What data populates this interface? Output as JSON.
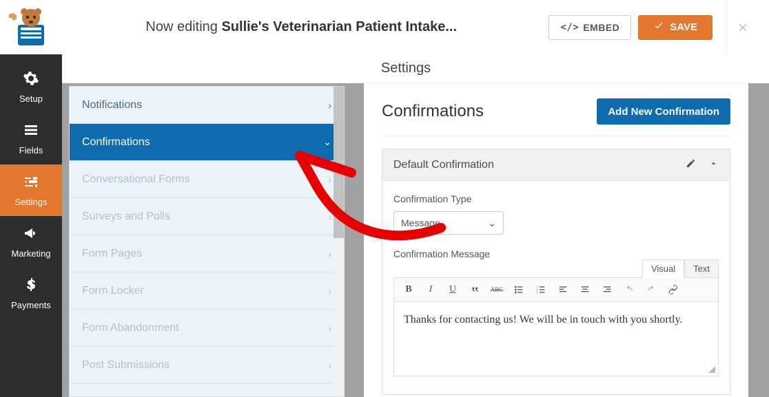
{
  "header": {
    "editing_prefix": "Now editing ",
    "editing_title": "Sullie's Veterinarian Patient Intake...",
    "embed_label": "EMBED",
    "save_label": "SAVE"
  },
  "sidebar": {
    "items": [
      {
        "label": "Setup",
        "icon": "gear"
      },
      {
        "label": "Fields",
        "icon": "list"
      },
      {
        "label": "Settings",
        "icon": "sliders"
      },
      {
        "label": "Marketing",
        "icon": "bullhorn"
      },
      {
        "label": "Payments",
        "icon": "dollar"
      }
    ],
    "active_index": 2
  },
  "settings_title": "Settings",
  "tree": {
    "items": [
      {
        "label": "Notifications",
        "state": "normal"
      },
      {
        "label": "Confirmations",
        "state": "active"
      },
      {
        "label": "Conversational Forms",
        "state": "disabled"
      },
      {
        "label": "Surveys and Polls",
        "state": "disabled"
      },
      {
        "label": "Form Pages",
        "state": "disabled"
      },
      {
        "label": "Form Locker",
        "state": "disabled"
      },
      {
        "label": "Form Abandonment",
        "state": "disabled"
      },
      {
        "label": "Post Submissions",
        "state": "disabled"
      }
    ]
  },
  "main": {
    "heading": "Confirmations",
    "add_button": "Add New Confirmation",
    "card_title": "Default Confirmation",
    "type_label": "Confirmation Type",
    "type_value": "Message",
    "msg_label": "Confirmation Message",
    "editor_tabs": {
      "visual": "Visual",
      "text": "Text"
    },
    "editor_text": "Thanks for contacting us! We will be in touch with you shortly."
  },
  "editor_toolbar": {
    "bold": "B",
    "italic": "I",
    "underline": "U",
    "strike": "ABC"
  }
}
